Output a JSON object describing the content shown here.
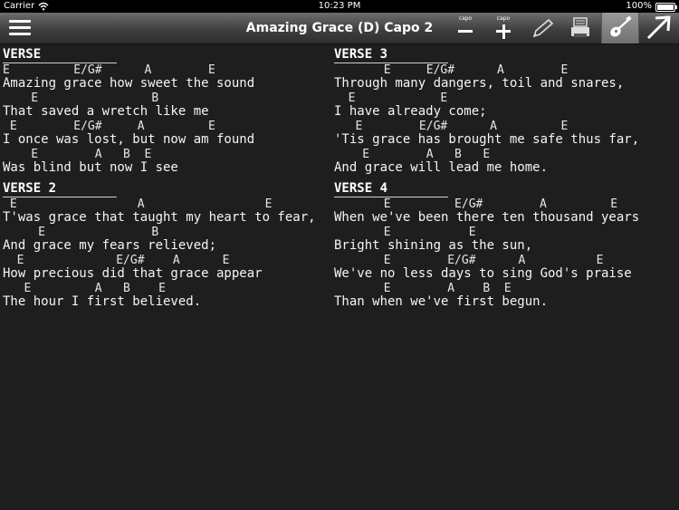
{
  "status": {
    "carrier": "Carrier",
    "time": "10:23 PM",
    "battery": "100%"
  },
  "toolbar": {
    "title": "Amazing Grace (D) Capo 2",
    "capo_down_label": "capo",
    "capo_up_label": "capo",
    "icons": [
      "menu-icon",
      "capo-minus-icon",
      "capo-plus-icon",
      "pencil-icon",
      "printer-icon",
      "guitar-icon",
      "arrow-up-right-icon"
    ]
  },
  "verses": {
    "verse1": {
      "heading": "VERSE",
      "lines": [
        {
          "chords": "E         E/G#      A        E",
          "lyric": "Amazing grace how sweet the sound"
        },
        {
          "chords": "    E                B",
          "lyric": "That saved a wretch like me"
        },
        {
          "chords": " E        E/G#     A         E",
          "lyric": "I once was lost, but now am found"
        },
        {
          "chords": "    E        A   B  E",
          "lyric": "Was blind but now I see"
        }
      ]
    },
    "verse2": {
      "heading": "VERSE 2",
      "lines": [
        {
          "chords": " E                 A                 E",
          "lyric": "T'was grace that taught my heart to fear,"
        },
        {
          "chords": "     E               B",
          "lyric": "And grace my fears relieved;"
        },
        {
          "chords": "  E             E/G#    A      E",
          "lyric": "How precious did that grace appear"
        },
        {
          "chords": "   E         A   B    E",
          "lyric": "The hour I first believed."
        }
      ]
    },
    "verse3": {
      "heading": "VERSE 3",
      "lines": [
        {
          "chords": "       E     E/G#      A        E",
          "lyric": "Through many dangers, toil and snares,"
        },
        {
          "chords": "  E            E",
          "lyric": "I have already come;"
        },
        {
          "chords": "   E        E/G#      A         E",
          "lyric": "'Tis grace has brought me safe thus far,"
        },
        {
          "chords": "    E        A   B   E",
          "lyric": "And grace will lead me home."
        }
      ]
    },
    "verse4": {
      "heading": "VERSE 4",
      "lines": [
        {
          "chords": "       E         E/G#        A         E",
          "lyric": "When we've been there ten thousand years"
        },
        {
          "chords": "       E           E",
          "lyric": "Bright shining as the sun,"
        },
        {
          "chords": "       E        E/G#      A          E",
          "lyric": "We've no less days to sing God's praise"
        },
        {
          "chords": "       E        A    B  E",
          "lyric": "Than when we've first begun."
        }
      ]
    }
  },
  "colors": {
    "background": "#1e1e1e",
    "toolbar_top": "#6d6d6d",
    "toolbar_bottom": "#2e2e2e",
    "text": "#f2f2f2"
  }
}
